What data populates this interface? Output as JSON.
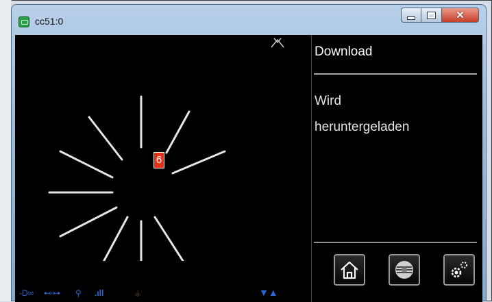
{
  "window": {
    "title": "cc51:0"
  },
  "panel": {
    "heading": "Download",
    "message_line1": "Wird",
    "message_line2": "heruntergeladen"
  },
  "spinner": {
    "badge_value": "6"
  },
  "buttons": [
    {
      "name": "home-button",
      "icon": "home-icon"
    },
    {
      "name": "disc-button",
      "icon": "disc-icon"
    },
    {
      "name": "settings-button",
      "icon": "gear-icon"
    }
  ],
  "status_icons": [
    "network-icon",
    "link-icon",
    "pin-icon",
    "signal-icon",
    "antenna-icon",
    "updown-icon"
  ],
  "colors": {
    "accent_blue": "#2c66d6",
    "badge_red": "#e53318",
    "background": "#000000"
  }
}
